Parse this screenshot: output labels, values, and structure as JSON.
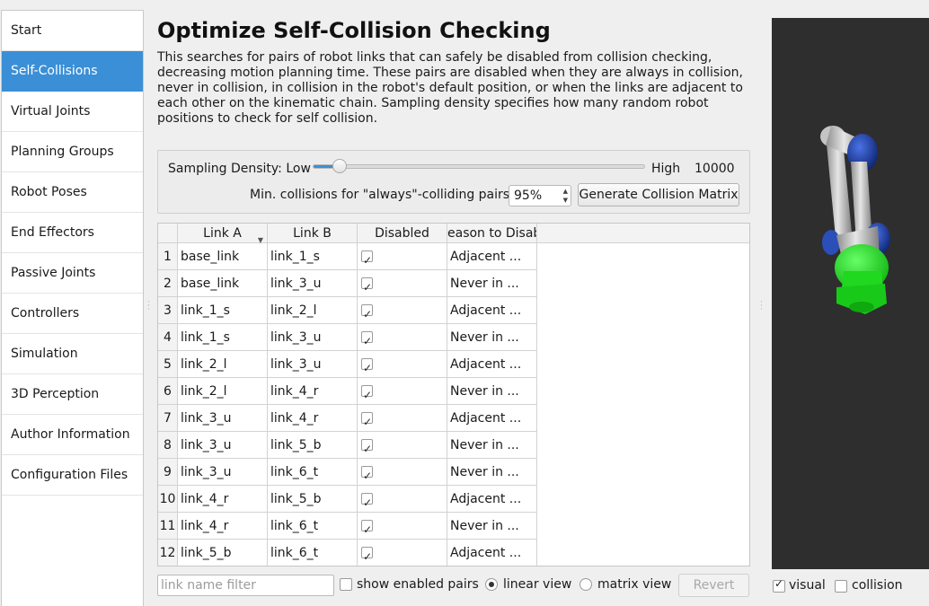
{
  "sidebar": {
    "items": [
      {
        "label": "Start"
      },
      {
        "label": "Self-Collisions",
        "active": true
      },
      {
        "label": "Virtual Joints"
      },
      {
        "label": "Planning Groups"
      },
      {
        "label": "Robot Poses"
      },
      {
        "label": "End Effectors"
      },
      {
        "label": "Passive Joints"
      },
      {
        "label": "Controllers"
      },
      {
        "label": "Simulation"
      },
      {
        "label": "3D Perception"
      },
      {
        "label": "Author Information"
      },
      {
        "label": "Configuration Files"
      }
    ]
  },
  "main": {
    "title": "Optimize Self-Collision Checking",
    "description": "This searches for pairs of robot links that can safely be disabled from collision checking, decreasing motion planning time. These pairs are disabled when they are always in collision, never in collision, in collision in the robot's default position, or when the links are adjacent to each other on the kinematic chain. Sampling density specifies how many random robot positions to check for self collision."
  },
  "settings": {
    "density_label": "Sampling Density: Low",
    "density_high_label": "High",
    "density_value": "10000",
    "density_fraction": 0.08,
    "min_collisions_label": "Min. collisions for \"always\"-colliding pairs:",
    "min_collisions_value": "95%",
    "generate_button": "Generate Collision Matrix"
  },
  "table": {
    "headers": [
      "Link A",
      "Link B",
      "Disabled",
      "Reason to Disable"
    ],
    "header_visible": [
      "Link A",
      "Link B",
      "Disabled",
      "eason to Disab"
    ],
    "rows": [
      {
        "num": "1",
        "a": "base_link",
        "b": "link_1_s",
        "disabled": true,
        "reason": "Adjacent ..."
      },
      {
        "num": "2",
        "a": "base_link",
        "b": "link_3_u",
        "disabled": true,
        "reason": "Never in ..."
      },
      {
        "num": "3",
        "a": "link_1_s",
        "b": "link_2_l",
        "disabled": true,
        "reason": "Adjacent ..."
      },
      {
        "num": "4",
        "a": "link_1_s",
        "b": "link_3_u",
        "disabled": true,
        "reason": "Never in ..."
      },
      {
        "num": "5",
        "a": "link_2_l",
        "b": "link_3_u",
        "disabled": true,
        "reason": "Adjacent ..."
      },
      {
        "num": "6",
        "a": "link_2_l",
        "b": "link_4_r",
        "disabled": true,
        "reason": "Never in ..."
      },
      {
        "num": "7",
        "a": "link_3_u",
        "b": "link_4_r",
        "disabled": true,
        "reason": "Adjacent ..."
      },
      {
        "num": "8",
        "a": "link_3_u",
        "b": "link_5_b",
        "disabled": true,
        "reason": "Never in ..."
      },
      {
        "num": "9",
        "a": "link_3_u",
        "b": "link_6_t",
        "disabled": true,
        "reason": "Never in ..."
      },
      {
        "num": "10",
        "a": "link_4_r",
        "b": "link_5_b",
        "disabled": true,
        "reason": "Adjacent ..."
      },
      {
        "num": "11",
        "a": "link_4_r",
        "b": "link_6_t",
        "disabled": true,
        "reason": "Never in ..."
      },
      {
        "num": "12",
        "a": "link_5_b",
        "b": "link_6_t",
        "disabled": true,
        "reason": "Adjacent ..."
      }
    ]
  },
  "bottom": {
    "filter_placeholder": "link name filter",
    "show_enabled_label": "show enabled pairs",
    "show_enabled_checked": false,
    "linear_view_label": "linear view",
    "matrix_view_label": "matrix view",
    "selected_view": "linear",
    "revert_button": "Revert"
  },
  "viewport": {
    "visual_label": "visual",
    "visual_checked": true,
    "collision_label": "collision",
    "collision_checked": false,
    "colors": {
      "background": "#2e2e2e",
      "highlight": "#22ee22",
      "link": "#c8c8c8",
      "joint": "#1b3fa8"
    }
  }
}
